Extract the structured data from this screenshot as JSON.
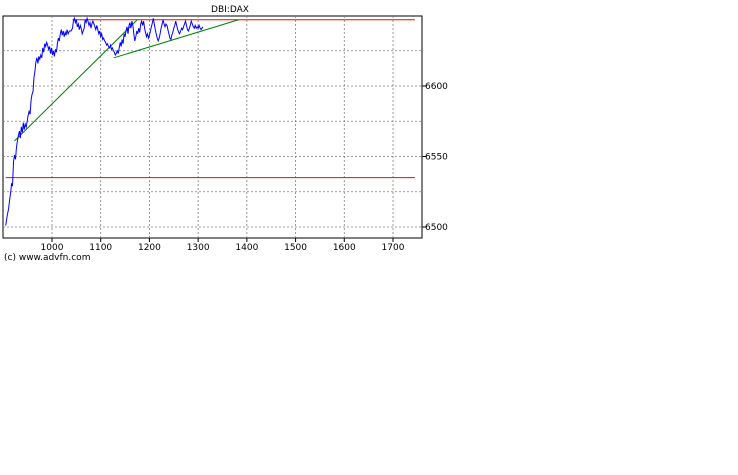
{
  "copyright": "(c) www.advfn.com",
  "chart_data": {
    "type": "line",
    "title": "DBI:DAX",
    "xlabel": "",
    "ylabel": "",
    "xlim": [
      905,
      1750
    ],
    "ylim": [
      6492,
      6545
    ],
    "x_ticks": [
      1000,
      1100,
      1200,
      1300,
      1400,
      1500,
      1600,
      1700
    ],
    "y_ticks": [
      6500,
      6550,
      6600
    ],
    "y_tick_side": "right",
    "grid": true,
    "colors": {
      "series": "#0000ff",
      "support_resistance": "#ff0000",
      "trendline": "#008000",
      "frame": "#000000",
      "grid": "#808080"
    },
    "series": [
      {
        "values": [
          [
            905,
            6501
          ],
          [
            908,
            6508
          ],
          [
            911,
            6513
          ],
          [
            913,
            6519
          ],
          [
            915,
            6524
          ],
          [
            917,
            6531
          ],
          [
            919,
            6529
          ],
          [
            921,
            6546
          ],
          [
            923,
            6551
          ],
          [
            925,
            6548
          ],
          [
            927,
            6556
          ],
          [
            929,
            6561
          ],
          [
            931,
            6565
          ],
          [
            933,
            6568
          ],
          [
            935,
            6563
          ],
          [
            937,
            6571
          ],
          [
            939,
            6567
          ],
          [
            941,
            6574
          ],
          [
            943,
            6569
          ],
          [
            945,
            6573
          ],
          [
            947,
            6571
          ],
          [
            949,
            6575
          ],
          [
            951,
            6579
          ],
          [
            953,
            6582
          ],
          [
            955,
            6580
          ],
          [
            957,
            6590
          ],
          [
            959,
            6594
          ],
          [
            961,
            6596
          ],
          [
            963,
            6606
          ],
          [
            965,
            6611
          ],
          [
            967,
            6617
          ],
          [
            969,
            6620
          ],
          [
            971,
            6616
          ],
          [
            973,
            6621
          ],
          [
            975,
            6619
          ],
          [
            977,
            6622
          ],
          [
            979,
            6620
          ],
          [
            981,
            6627
          ],
          [
            983,
            6624
          ],
          [
            985,
            6630
          ],
          [
            987,
            6628
          ],
          [
            989,
            6631
          ],
          [
            991,
            6629
          ],
          [
            993,
            6626
          ],
          [
            995,
            6628
          ],
          [
            997,
            6623
          ],
          [
            999,
            6627
          ],
          [
            1001,
            6622
          ],
          [
            1003,
            6625
          ],
          [
            1005,
            6621
          ],
          [
            1007,
            6626
          ],
          [
            1009,
            6624
          ],
          [
            1011,
            6630
          ],
          [
            1013,
            6634
          ],
          [
            1015,
            6632
          ],
          [
            1017,
            6637
          ],
          [
            1019,
            6640
          ],
          [
            1021,
            6636
          ],
          [
            1023,
            6639
          ],
          [
            1025,
            6635
          ],
          [
            1027,
            6638
          ],
          [
            1029,
            6636
          ],
          [
            1031,
            6640
          ],
          [
            1033,
            6637
          ],
          [
            1036,
            6639
          ],
          [
            1039,
            6639
          ],
          [
            1042,
            6641
          ],
          [
            1044,
            6646
          ],
          [
            1046,
            6648
          ],
          [
            1048,
            6645
          ],
          [
            1050,
            6647
          ],
          [
            1052,
            6642
          ],
          [
            1054,
            6644
          ],
          [
            1056,
            6640
          ],
          [
            1058,
            6643
          ],
          [
            1060,
            6641
          ],
          [
            1062,
            6637
          ],
          [
            1064,
            6639
          ],
          [
            1066,
            6641
          ],
          [
            1068,
            6647
          ],
          [
            1070,
            6645
          ],
          [
            1072,
            6648
          ],
          [
            1074,
            6646
          ],
          [
            1076,
            6643
          ],
          [
            1078,
            6645
          ],
          [
            1080,
            6641
          ],
          [
            1082,
            6644
          ],
          [
            1084,
            6646
          ],
          [
            1086,
            6644
          ],
          [
            1088,
            6642
          ],
          [
            1090,
            6640
          ],
          [
            1092,
            6643
          ],
          [
            1094,
            6640
          ],
          [
            1096,
            6637
          ],
          [
            1098,
            6639
          ],
          [
            1100,
            6635
          ],
          [
            1102,
            6637
          ],
          [
            1104,
            6633
          ],
          [
            1106,
            6634
          ],
          [
            1108,
            6632
          ],
          [
            1110,
            6631
          ],
          [
            1112,
            6629
          ],
          [
            1114,
            6630
          ],
          [
            1116,
            6628
          ],
          [
            1118,
            6627
          ],
          [
            1120,
            6629
          ],
          [
            1122,
            6626
          ],
          [
            1124,
            6627
          ],
          [
            1126,
            6625
          ],
          [
            1128,
            6624
          ],
          [
            1130,
            6622
          ],
          [
            1132,
            6623
          ],
          [
            1134,
            6625
          ],
          [
            1136,
            6623
          ],
          [
            1138,
            6627
          ],
          [
            1140,
            6631
          ],
          [
            1142,
            6628
          ],
          [
            1144,
            6633
          ],
          [
            1146,
            6630
          ],
          [
            1148,
            6637
          ],
          [
            1150,
            6635
          ],
          [
            1152,
            6639
          ],
          [
            1154,
            6642
          ],
          [
            1156,
            6637
          ],
          [
            1158,
            6643
          ],
          [
            1160,
            6645
          ],
          [
            1162,
            6641
          ],
          [
            1164,
            6646
          ],
          [
            1166,
            6643
          ],
          [
            1168,
            6637
          ],
          [
            1170,
            6632
          ],
          [
            1172,
            6635
          ],
          [
            1174,
            6639
          ],
          [
            1176,
            6637
          ],
          [
            1178,
            6641
          ],
          [
            1180,
            6638
          ],
          [
            1182,
            6644
          ],
          [
            1184,
            6646
          ],
          [
            1186,
            6643
          ],
          [
            1188,
            6646
          ],
          [
            1190,
            6641
          ],
          [
            1192,
            6638
          ],
          [
            1194,
            6635
          ],
          [
            1196,
            6637
          ],
          [
            1198,
            6634
          ],
          [
            1200,
            6636
          ],
          [
            1202,
            6639
          ],
          [
            1204,
            6642
          ],
          [
            1206,
            6645
          ],
          [
            1208,
            6648
          ],
          [
            1210,
            6644
          ],
          [
            1212,
            6640
          ],
          [
            1214,
            6637
          ],
          [
            1216,
            6634
          ],
          [
            1218,
            6632
          ],
          [
            1220,
            6634
          ],
          [
            1222,
            6637
          ],
          [
            1224,
            6641
          ],
          [
            1226,
            6644
          ],
          [
            1228,
            6647
          ],
          [
            1230,
            6644
          ],
          [
            1232,
            6642
          ],
          [
            1234,
            6644
          ],
          [
            1236,
            6643
          ],
          [
            1238,
            6640
          ],
          [
            1240,
            6637
          ],
          [
            1242,
            6634
          ],
          [
            1244,
            6633
          ],
          [
            1246,
            6636
          ],
          [
            1248,
            6638
          ],
          [
            1250,
            6641
          ],
          [
            1252,
            6643
          ],
          [
            1254,
            6646
          ],
          [
            1256,
            6643
          ],
          [
            1258,
            6640
          ],
          [
            1260,
            6638
          ],
          [
            1262,
            6637
          ],
          [
            1264,
            6639
          ],
          [
            1266,
            6641
          ],
          [
            1268,
            6640
          ],
          [
            1270,
            6642
          ],
          [
            1272,
            6644
          ],
          [
            1274,
            6646
          ],
          [
            1276,
            6643
          ],
          [
            1278,
            6640
          ],
          [
            1280,
            6639
          ],
          [
            1282,
            6641
          ],
          [
            1284,
            6643
          ],
          [
            1286,
            6646
          ],
          [
            1288,
            6644
          ],
          [
            1290,
            6642
          ],
          [
            1292,
            6641
          ],
          [
            1294,
            6643
          ],
          [
            1296,
            6641
          ],
          [
            1298,
            6642
          ],
          [
            1300,
            6641
          ],
          [
            1302,
            6643
          ],
          [
            1304,
            6641
          ],
          [
            1306,
            6640
          ],
          [
            1308,
            6641
          ],
          [
            1310,
            6642
          ]
        ]
      }
    ],
    "reference_lines": [
      {
        "kind": "horizontal",
        "y": 6647,
        "x_from": 1042,
        "x_to": 1745,
        "color": "#ff0000"
      },
      {
        "kind": "horizontal",
        "y": 6535,
        "x_from": 905,
        "x_to": 1745,
        "color": "#ff0000"
      }
    ],
    "trendlines": [
      {
        "from": [
          923,
          6561
        ],
        "to": [
          1175,
          6647
        ],
        "color": "#008000"
      },
      {
        "from": [
          1127,
          6620
        ],
        "to": [
          1383,
          6647
        ],
        "color": "#008000"
      }
    ]
  }
}
